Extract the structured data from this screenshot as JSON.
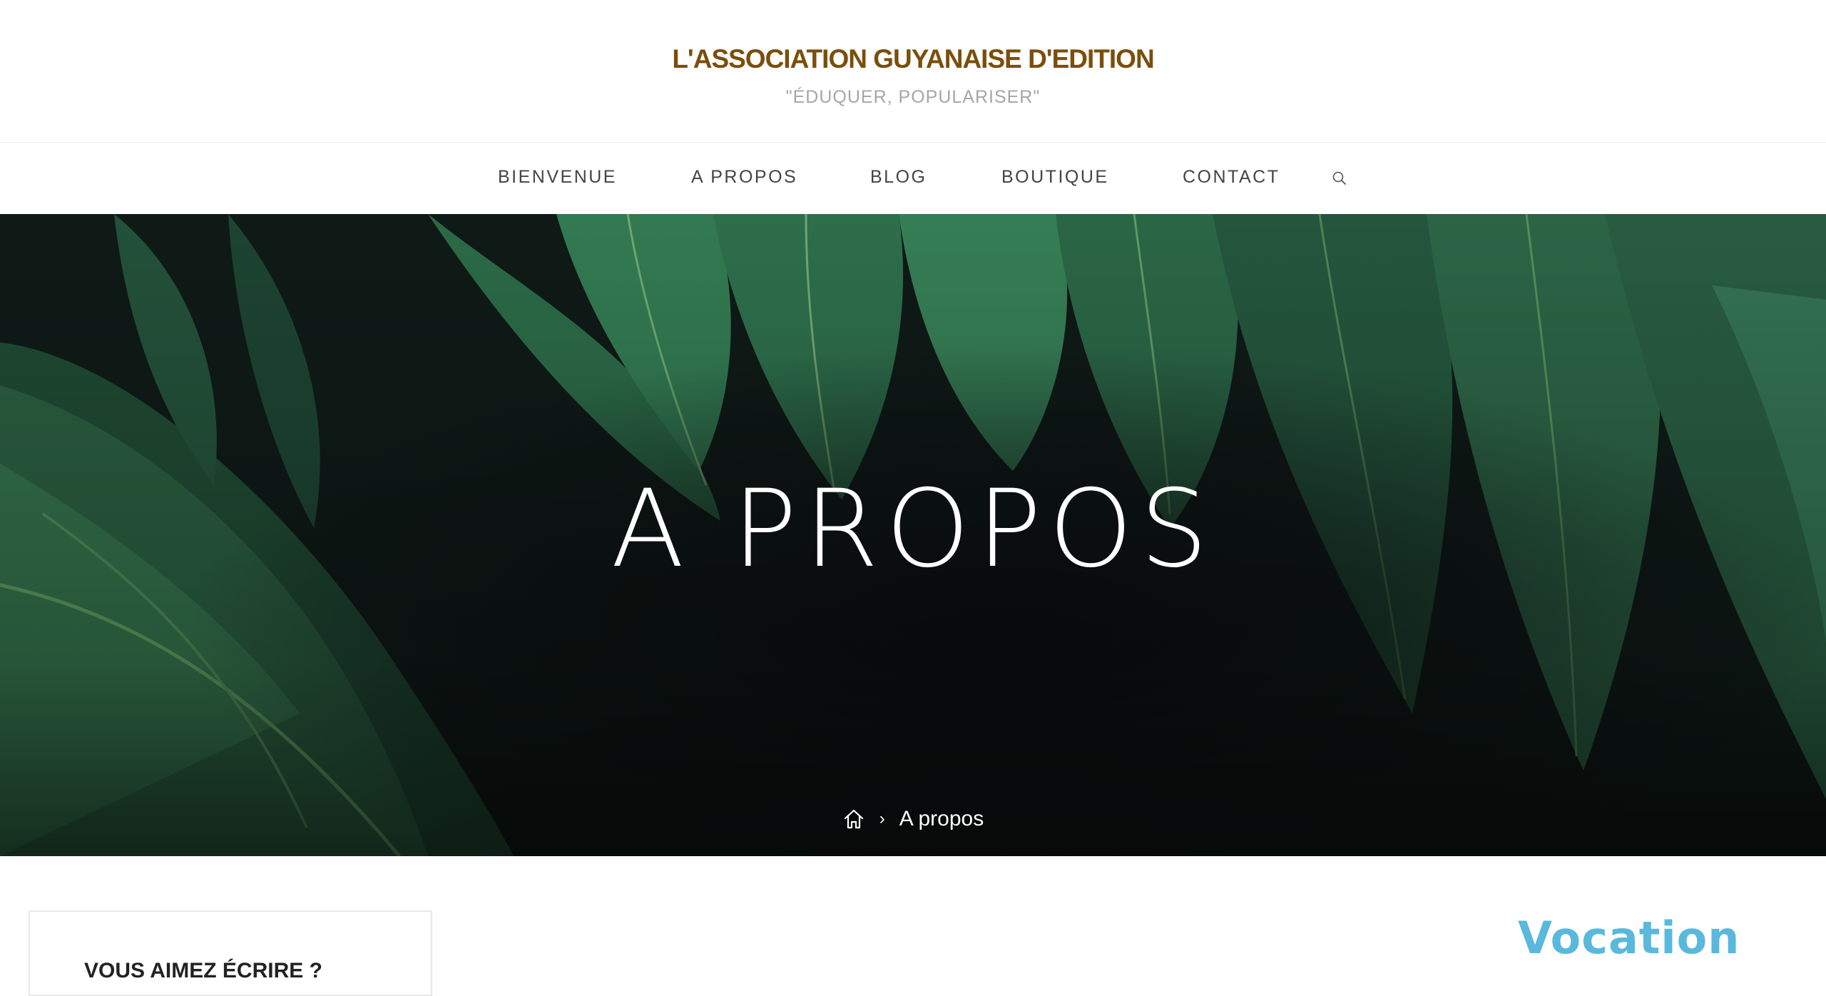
{
  "site": {
    "title": "L'ASSOCIATION GUYANAISE D'EDITION",
    "tagline": "\"ÉDUQUER, POPULARISER\""
  },
  "nav": {
    "items": [
      {
        "label": "BIENVENUE"
      },
      {
        "label": "A PROPOS"
      },
      {
        "label": "BLOG"
      },
      {
        "label": "BOUTIQUE"
      },
      {
        "label": "CONTACT"
      }
    ],
    "search_icon": "search-icon"
  },
  "hero": {
    "title": "A PROPOS",
    "breadcrumb": {
      "home_icon": "home-icon",
      "separator": "›",
      "current": "A propos"
    }
  },
  "sidebar": {
    "title": "VOUS AIMEZ ÉCRIRE ?"
  },
  "content": {
    "heading": "Vocation"
  },
  "colors": {
    "site_title": "#7a4e0b",
    "tagline": "#a6a6a6",
    "nav_text": "#444444",
    "heading_accent": "#5ab8dc",
    "hero_bg": "#0d1412"
  }
}
